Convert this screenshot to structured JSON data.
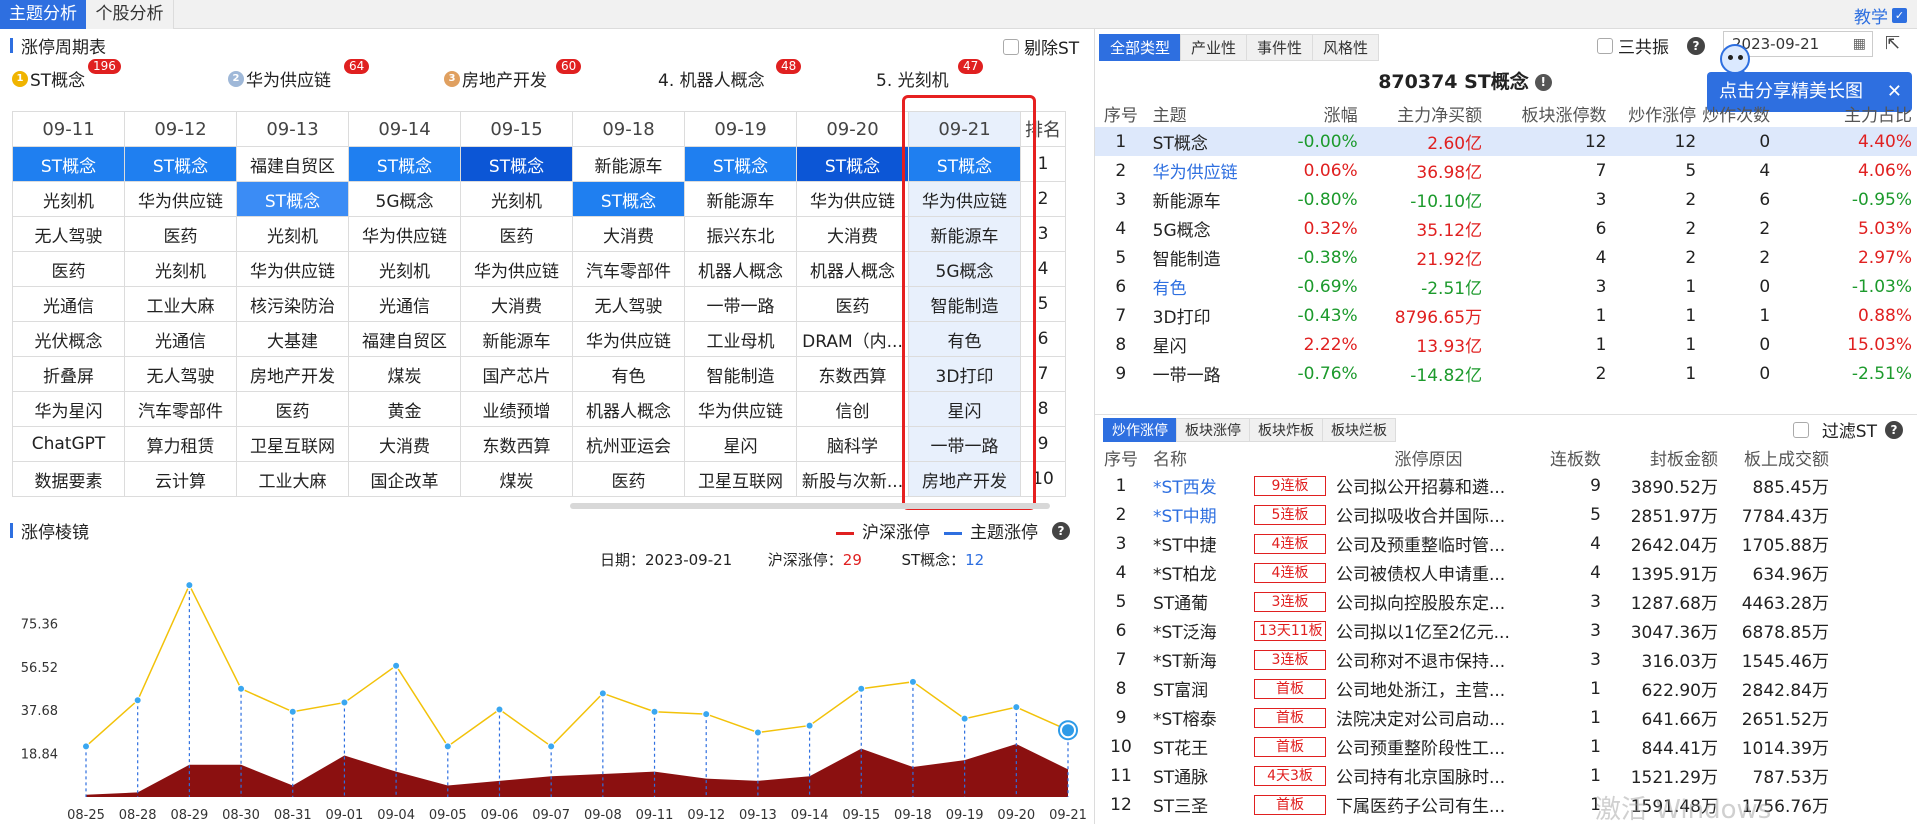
{
  "top_tabs": [
    "主题分析",
    "个股分析"
  ],
  "teach_label": "教学",
  "left": {
    "title": "涨停周期表",
    "exclude_st": "剔除ST",
    "themes": [
      {
        "label": "ST概念",
        "count": "196"
      },
      {
        "label": "华为供应链",
        "count": "64"
      },
      {
        "label": "房地产开发",
        "count": "60"
      },
      {
        "label": "4. 机器人概念",
        "count": "48"
      },
      {
        "label": "5. 光刻机",
        "count": "47"
      }
    ],
    "dates": [
      "09-11",
      "09-12",
      "09-13",
      "09-14",
      "09-15",
      "09-18",
      "09-19",
      "09-20",
      "09-21"
    ],
    "rank_header": "排名",
    "rows": [
      [
        "ST概念",
        "ST概念",
        "福建自贸区",
        "ST概念",
        "ST概念",
        "新能源车",
        "ST概念",
        "ST概念",
        "ST概念"
      ],
      [
        "光刻机",
        "华为供应链",
        "ST概念",
        "5G概念",
        "光刻机",
        "ST概念",
        "新能源车",
        "华为供应链",
        "华为供应链"
      ],
      [
        "无人驾驶",
        "医药",
        "光刻机",
        "华为供应链",
        "医药",
        "大消费",
        "振兴东北",
        "大消费",
        "新能源车"
      ],
      [
        "医药",
        "光刻机",
        "华为供应链",
        "光刻机",
        "华为供应链",
        "汽车零部件",
        "机器人概念",
        "机器人概念",
        "5G概念"
      ],
      [
        "光通信",
        "工业大麻",
        "核污染防治",
        "光通信",
        "大消费",
        "无人驾驶",
        "一带一路",
        "医药",
        "智能制造"
      ],
      [
        "光伏概念",
        "光通信",
        "大基建",
        "福建自贸区",
        "新能源车",
        "华为供应链",
        "工业母机",
        "DRAM（内...",
        "有色"
      ],
      [
        "折叠屏",
        "无人驾驶",
        "房地产开发",
        "煤炭",
        "国产芯片",
        "有色",
        "智能制造",
        "东数西算",
        "3D打印"
      ],
      [
        "华为星闪",
        "汽车零部件",
        "医药",
        "黄金",
        "业绩预增",
        "机器人概念",
        "华为供应链",
        "信创",
        "星闪"
      ],
      [
        "ChatGPT",
        "算力租赁",
        "卫星互联网",
        "大消费",
        "东数西算",
        "杭州亚运会",
        "星闪",
        "脑科学",
        "一带一路"
      ],
      [
        "数据要素",
        "云计算",
        "工业大麻",
        "国企改革",
        "煤炭",
        "医药",
        "卫星互联网",
        "新股与次新...",
        "房地产开发"
      ]
    ],
    "ranks": [
      "1",
      "2",
      "3",
      "4",
      "5",
      "6",
      "7",
      "8",
      "9",
      "10"
    ]
  },
  "chart": {
    "title": "涨停棱镜",
    "legend_market": "沪深涨停",
    "legend_theme": "主题涨停",
    "info_date_label": "日期：",
    "info_date": "2023-09-21",
    "info_market_label": "沪深涨停：",
    "info_market": "29",
    "info_theme_label": "ST概念：",
    "info_theme": "12",
    "color_market": "#e02020",
    "color_theme": "#2e6fe0"
  },
  "chart_data": {
    "type": "line",
    "x": [
      "08-25",
      "08-28",
      "08-29",
      "08-30",
      "08-31",
      "09-01",
      "09-04",
      "09-05",
      "09-06",
      "09-07",
      "09-08",
      "09-11",
      "09-12",
      "09-13",
      "09-14",
      "09-15",
      "09-18",
      "09-19",
      "09-20",
      "09-21"
    ],
    "yticks": [
      18.84,
      37.68,
      56.52,
      75.36
    ],
    "ylim": [
      0,
      94.2
    ],
    "series": [
      {
        "name": "沪深涨停",
        "values": [
          22,
          42,
          92,
          47,
          37,
          41,
          57,
          22,
          38,
          22,
          45,
          37,
          36,
          28,
          31,
          47,
          50,
          34,
          39,
          29
        ]
      },
      {
        "name": "主题涨停",
        "values": [
          1,
          2,
          14,
          14,
          5,
          18,
          11,
          5,
          7,
          9,
          10,
          11,
          8,
          7,
          9,
          21,
          13,
          16,
          23,
          12
        ]
      }
    ]
  },
  "right": {
    "tabs": [
      "全部类型",
      "产业性",
      "事件性",
      "风格性"
    ],
    "sangong": "三共振",
    "date": "2023-09-21",
    "tooltip": "点击分享精美长图",
    "title": "870374 ST概念",
    "t1_headers": [
      "序号",
      "主题",
      "涨幅",
      "主力净买额",
      "板块涨停数",
      "炒作涨停",
      "炒作次数",
      "主力占比"
    ],
    "t1_rows": [
      {
        "no": "1",
        "name": "ST概念",
        "chg": "-0.00%",
        "net": "2.60亿",
        "limit": "12",
        "hype": "12",
        "times": "0",
        "ratio": "4.40%",
        "nameColor": "#222",
        "chgColor": "#1c9a2c",
        "netColor": "#e02020",
        "ratioColor": "#e02020"
      },
      {
        "no": "2",
        "name": "华为供应链",
        "chg": "0.06%",
        "net": "36.98亿",
        "limit": "7",
        "hype": "5",
        "times": "4",
        "ratio": "4.06%",
        "nameColor": "#2e6fe0",
        "chgColor": "#e02020",
        "netColor": "#e02020",
        "ratioColor": "#e02020"
      },
      {
        "no": "3",
        "name": "新能源车",
        "chg": "-0.80%",
        "net": "-10.10亿",
        "limit": "3",
        "hype": "2",
        "times": "6",
        "ratio": "-0.95%",
        "nameColor": "#222",
        "chgColor": "#1c9a2c",
        "netColor": "#1c9a2c",
        "ratioColor": "#1c9a2c"
      },
      {
        "no": "4",
        "name": "5G概念",
        "chg": "0.32%",
        "net": "35.12亿",
        "limit": "6",
        "hype": "2",
        "times": "2",
        "ratio": "5.03%",
        "nameColor": "#222",
        "chgColor": "#e02020",
        "netColor": "#e02020",
        "ratioColor": "#e02020"
      },
      {
        "no": "5",
        "name": "智能制造",
        "chg": "-0.38%",
        "net": "21.92亿",
        "limit": "4",
        "hype": "2",
        "times": "2",
        "ratio": "2.97%",
        "nameColor": "#222",
        "chgColor": "#1c9a2c",
        "netColor": "#e02020",
        "ratioColor": "#e02020"
      },
      {
        "no": "6",
        "name": "有色",
        "chg": "-0.69%",
        "net": "-2.51亿",
        "limit": "3",
        "hype": "1",
        "times": "0",
        "ratio": "-1.03%",
        "nameColor": "#2e6fe0",
        "chgColor": "#1c9a2c",
        "netColor": "#1c9a2c",
        "ratioColor": "#1c9a2c"
      },
      {
        "no": "7",
        "name": "3D打印",
        "chg": "-0.43%",
        "net": "8796.65万",
        "limit": "1",
        "hype": "1",
        "times": "1",
        "ratio": "0.88%",
        "nameColor": "#222",
        "chgColor": "#1c9a2c",
        "netColor": "#e02020",
        "ratioColor": "#e02020"
      },
      {
        "no": "8",
        "name": "星闪",
        "chg": "2.22%",
        "net": "13.93亿",
        "limit": "1",
        "hype": "1",
        "times": "0",
        "ratio": "15.03%",
        "nameColor": "#222",
        "chgColor": "#e02020",
        "netColor": "#e02020",
        "ratioColor": "#e02020"
      },
      {
        "no": "9",
        "name": "一带一路",
        "chg": "-0.76%",
        "net": "-14.82亿",
        "limit": "2",
        "hype": "1",
        "times": "0",
        "ratio": "-2.51%",
        "nameColor": "#222",
        "chgColor": "#1c9a2c",
        "netColor": "#1c9a2c",
        "ratioColor": "#1c9a2c"
      }
    ],
    "btabs": [
      "炒作涨停",
      "板块涨停",
      "板块炸板",
      "板块烂板"
    ],
    "filter_st": "过滤ST",
    "t2_headers": [
      "序号",
      "名称",
      "涨停原因",
      "连板数",
      "封板金额",
      "板上成交额"
    ],
    "t2_rows": [
      {
        "no": "1",
        "name": "*ST西发",
        "tag": "9连板",
        "reason": "公司拟公开招募和遴...",
        "lb": "9",
        "seal": "3890.52万",
        "vol": "885.45万",
        "nameColor": "#2e6fe0"
      },
      {
        "no": "2",
        "name": "*ST中期",
        "tag": "5连板",
        "reason": "公司拟吸收合并国际...",
        "lb": "5",
        "seal": "2851.97万",
        "vol": "7784.43万",
        "nameColor": "#2e6fe0"
      },
      {
        "no": "3",
        "name": "*ST中捷",
        "tag": "4连板",
        "reason": "公司及预重整临时管...",
        "lb": "4",
        "seal": "2642.04万",
        "vol": "1705.88万",
        "nameColor": "#222"
      },
      {
        "no": "4",
        "name": "*ST柏龙",
        "tag": "4连板",
        "reason": "公司被债权人申请重...",
        "lb": "4",
        "seal": "1395.91万",
        "vol": "634.96万",
        "nameColor": "#222"
      },
      {
        "no": "5",
        "name": "ST通葡",
        "tag": "3连板",
        "reason": "公司拟向控股股东定...",
        "lb": "3",
        "seal": "1287.68万",
        "vol": "4463.28万",
        "nameColor": "#222"
      },
      {
        "no": "6",
        "name": "*ST泛海",
        "tag": "13天11板",
        "reason": "公司拟以1亿至2亿元...",
        "lb": "3",
        "seal": "3047.36万",
        "vol": "6878.85万",
        "nameColor": "#222"
      },
      {
        "no": "7",
        "name": "*ST新海",
        "tag": "3连板",
        "reason": "公司称对不退市保持...",
        "lb": "3",
        "seal": "316.03万",
        "vol": "1545.46万",
        "nameColor": "#222"
      },
      {
        "no": "8",
        "name": "ST富润",
        "tag": "首板",
        "reason": "公司地处浙江，主营...",
        "lb": "1",
        "seal": "622.90万",
        "vol": "2842.84万",
        "nameColor": "#222"
      },
      {
        "no": "9",
        "name": "*ST榕泰",
        "tag": "首板",
        "reason": "法院决定对公司启动...",
        "lb": "1",
        "seal": "641.66万",
        "vol": "2651.52万",
        "nameColor": "#222"
      },
      {
        "no": "10",
        "name": "ST花王",
        "tag": "首板",
        "reason": "公司预重整阶段性工...",
        "lb": "1",
        "seal": "844.41万",
        "vol": "1014.39万",
        "nameColor": "#222"
      },
      {
        "no": "11",
        "name": "ST通脉",
        "tag": "4天3板",
        "reason": "公司持有北京国脉时...",
        "lb": "1",
        "seal": "1521.29万",
        "vol": "787.53万",
        "nameColor": "#222"
      },
      {
        "no": "12",
        "name": "ST三圣",
        "tag": "首板",
        "reason": "下属医药子公司有生...",
        "lb": "1",
        "seal": "1591.48万",
        "vol": "1756.76万",
        "nameColor": "#222"
      }
    ],
    "watermark": "激活 Windows"
  }
}
